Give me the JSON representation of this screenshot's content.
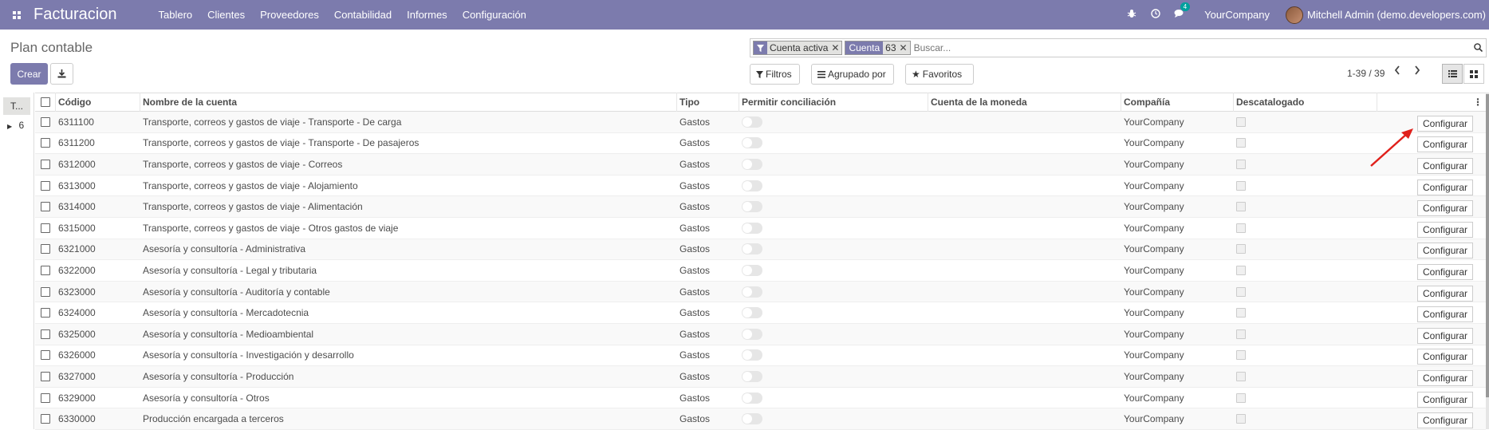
{
  "navbar": {
    "apps_icon": "apps-grid-icon",
    "brand": "Facturacion",
    "menu": [
      "Tablero",
      "Clientes",
      "Proveedores",
      "Contabilidad",
      "Informes",
      "Configuración"
    ],
    "bug_icon": "bug-icon",
    "clock_icon": "clock-icon",
    "messages_icon": "comments-icon",
    "messages_count": "4",
    "company": "YourCompany",
    "user": "Mitchell Admin (demo.developers.com)"
  },
  "control_panel": {
    "title": "Plan contable",
    "create_label": "Crear",
    "download_icon": "download-icon",
    "facets": [
      {
        "icon": "filter-icon",
        "label": "Cuenta activa"
      },
      {
        "icon_label": "Cuenta",
        "label": "63"
      }
    ],
    "search_placeholder": "Buscar...",
    "filters_label": "Filtros",
    "groupby_label": "Agrupado por",
    "favorites_label": "Favoritos",
    "pager": "1-39 / 39",
    "views": [
      "list-icon",
      "kanban-icon"
    ]
  },
  "side_panel": {
    "active": "T...",
    "item": "6"
  },
  "table": {
    "headers": [
      "Código",
      "Nombre de la cuenta",
      "Tipo",
      "Permitir conciliación",
      "Cuenta de la moneda",
      "Compañía",
      "Descatalogado"
    ],
    "action_label": "Configurar",
    "rows": [
      {
        "code": "6311100",
        "name": "Transporte, correos y gastos de viaje - Transporte - De carga",
        "type": "Gastos",
        "company": "YourCompany"
      },
      {
        "code": "6311200",
        "name": "Transporte, correos y gastos de viaje - Transporte - De pasajeros",
        "type": "Gastos",
        "company": "YourCompany"
      },
      {
        "code": "6312000",
        "name": "Transporte, correos y gastos de viaje - Correos",
        "type": "Gastos",
        "company": "YourCompany"
      },
      {
        "code": "6313000",
        "name": "Transporte, correos y gastos de viaje - Alojamiento",
        "type": "Gastos",
        "company": "YourCompany"
      },
      {
        "code": "6314000",
        "name": "Transporte, correos y gastos de viaje - Alimentación",
        "type": "Gastos",
        "company": "YourCompany"
      },
      {
        "code": "6315000",
        "name": "Transporte, correos y gastos de viaje - Otros gastos de viaje",
        "type": "Gastos",
        "company": "YourCompany"
      },
      {
        "code": "6321000",
        "name": "Asesoría y consultoría - Administrativa",
        "type": "Gastos",
        "company": "YourCompany"
      },
      {
        "code": "6322000",
        "name": "Asesoría y consultoría - Legal y tributaria",
        "type": "Gastos",
        "company": "YourCompany"
      },
      {
        "code": "6323000",
        "name": "Asesoría y consultoría - Auditoría y contable",
        "type": "Gastos",
        "company": "YourCompany"
      },
      {
        "code": "6324000",
        "name": "Asesoría y consultoría - Mercadotecnia",
        "type": "Gastos",
        "company": "YourCompany"
      },
      {
        "code": "6325000",
        "name": "Asesoría y consultoría - Medioambiental",
        "type": "Gastos",
        "company": "YourCompany"
      },
      {
        "code": "6326000",
        "name": "Asesoría y consultoría - Investigación y desarrollo",
        "type": "Gastos",
        "company": "YourCompany"
      },
      {
        "code": "6327000",
        "name": "Asesoría y consultoría - Producción",
        "type": "Gastos",
        "company": "YourCompany"
      },
      {
        "code": "6329000",
        "name": "Asesoría y consultoría - Otros",
        "type": "Gastos",
        "company": "YourCompany"
      },
      {
        "code": "6330000",
        "name": "Producción encargada a terceros",
        "type": "Gastos",
        "company": "YourCompany"
      }
    ]
  },
  "colors": {
    "brand": "#7c7bad",
    "annotation_arrow": "#e0201b"
  }
}
